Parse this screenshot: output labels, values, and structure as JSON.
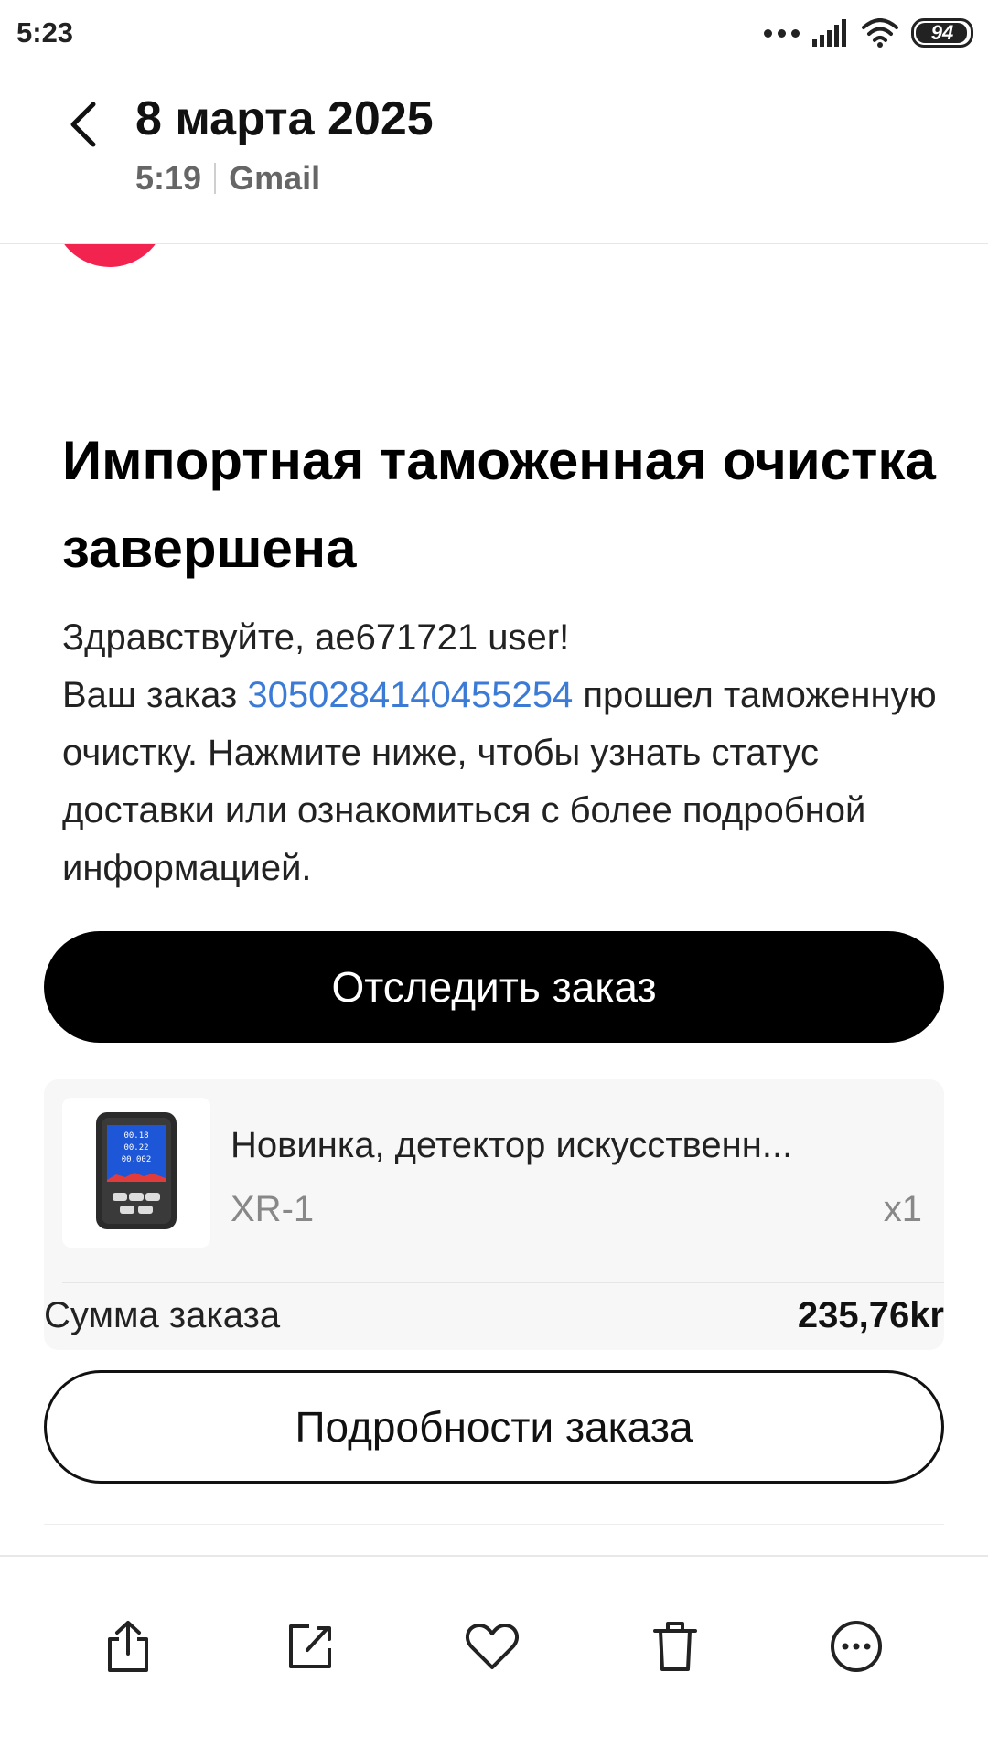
{
  "status_bar": {
    "time": "5:23",
    "battery": "94"
  },
  "header": {
    "title": "8 марта 2025",
    "time": "5:19",
    "source": "Gmail"
  },
  "email": {
    "subject": "Импортная таможенная очистка завершена",
    "greeting": "Здравствуйте, ae671721 user!",
    "body_prefix": "Ваш заказ ",
    "order_number": "3050284140455254",
    "body_suffix": " прошел таможенную очистку. Нажмите ниже, чтобы узнать статус доставки или ознакомиться с более подробной информацией.",
    "track_button": "Отследить заказ",
    "details_button": "Подробности заказа"
  },
  "order": {
    "product_title": "Новинка, детектор искусственн...",
    "variant": "XR-1",
    "quantity": "x1",
    "total_label": "Сумма заказа",
    "total_value": "235,76kr",
    "device_readings": [
      "00.18",
      "00.22",
      "00.002"
    ]
  },
  "toolbar": {
    "icons": [
      "share-icon",
      "edit-icon",
      "heart-icon",
      "trash-icon",
      "more-icon"
    ]
  },
  "colors": {
    "link": "#3b7bd6",
    "avatar": "#f3234f",
    "button": "#000000"
  }
}
